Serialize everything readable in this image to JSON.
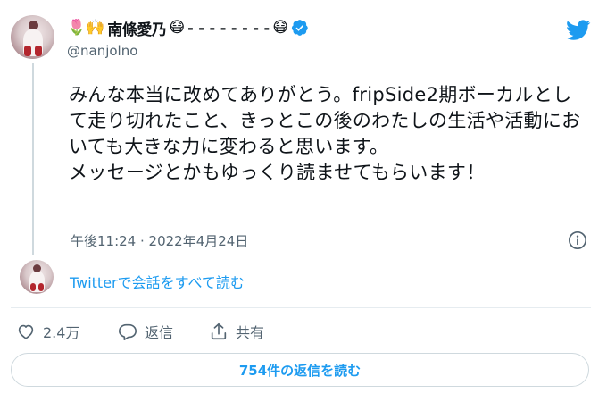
{
  "header": {
    "emoji_prefix": "🌷🙌",
    "display_name": "南條愛乃",
    "emoji_mask_1": "😷",
    "dashes": "- - - - - - - -",
    "emoji_mask_2": "😷",
    "handle": "@nanjolno"
  },
  "tweet": {
    "text": "みんな本当に改めてありがとう。fripSide2期ボーカルとして走り切れたこと、きっとこの後のわたしの生活や活動においても大きな力に変わると思います。\nメッセージとかもゆっくり読ませてもらいます！",
    "timestamp": "午後11:24 · 2022年4月24日"
  },
  "conversation_link": "Twitterで会話をすべて読む",
  "actions": {
    "like_count": "2.4万",
    "reply_label": "返信",
    "share_label": "共有"
  },
  "replies_button": "754件の返信を読む",
  "colors": {
    "accent": "#1d9bf0",
    "secondary_text": "#536471",
    "primary_text": "#0f1419"
  },
  "icons": {
    "twitter": "twitter-bird-icon",
    "verified": "verified-badge-icon",
    "info": "info-icon",
    "like": "heart-icon",
    "reply": "speech-bubble-icon",
    "share": "share-upload-icon"
  }
}
